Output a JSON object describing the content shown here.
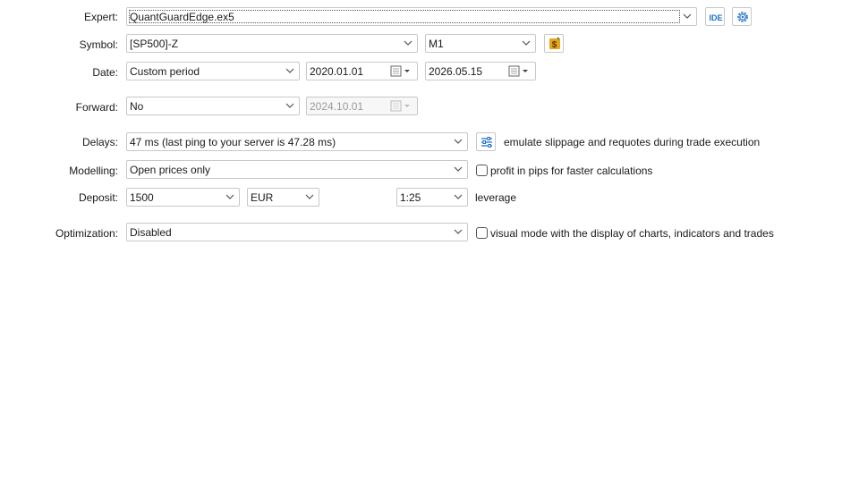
{
  "expert": {
    "label": "Expert:",
    "value": "QuantGuardEdge.ex5",
    "ide_icon_text": "IDE",
    "settings_icon": "gear-icon"
  },
  "symbol": {
    "label": "Symbol:",
    "value": "[SP500]-Z",
    "timeframe": "M1",
    "symbol_icon": "symbol-properties-icon"
  },
  "date": {
    "label": "Date:",
    "period": "Custom period",
    "from": "2020.01.01",
    "to": "2026.05.15"
  },
  "forward": {
    "label": "Forward:",
    "value": "No",
    "date": "2024.10.01"
  },
  "delays": {
    "label": "Delays:",
    "value": "47 ms (last ping to your server is 47.28 ms)",
    "emulate_text": "emulate slippage and requotes during trade execution"
  },
  "modelling": {
    "label": "Modelling:",
    "value": "Open prices only",
    "option_text": "profit in pips for faster calculations",
    "option_checked": false
  },
  "deposit": {
    "label": "Deposit:",
    "value": "1500",
    "currency": "EUR",
    "leverage_value": "1:25",
    "leverage_text": "leverage"
  },
  "optimization": {
    "label": "Optimization:",
    "value": "Disabled",
    "visual_text": "visual mode with the display of charts, indicators and trades",
    "visual_checked": false
  },
  "colors": {
    "accent": "#1e6fc4",
    "symbol_icon": "#e5a41e"
  }
}
